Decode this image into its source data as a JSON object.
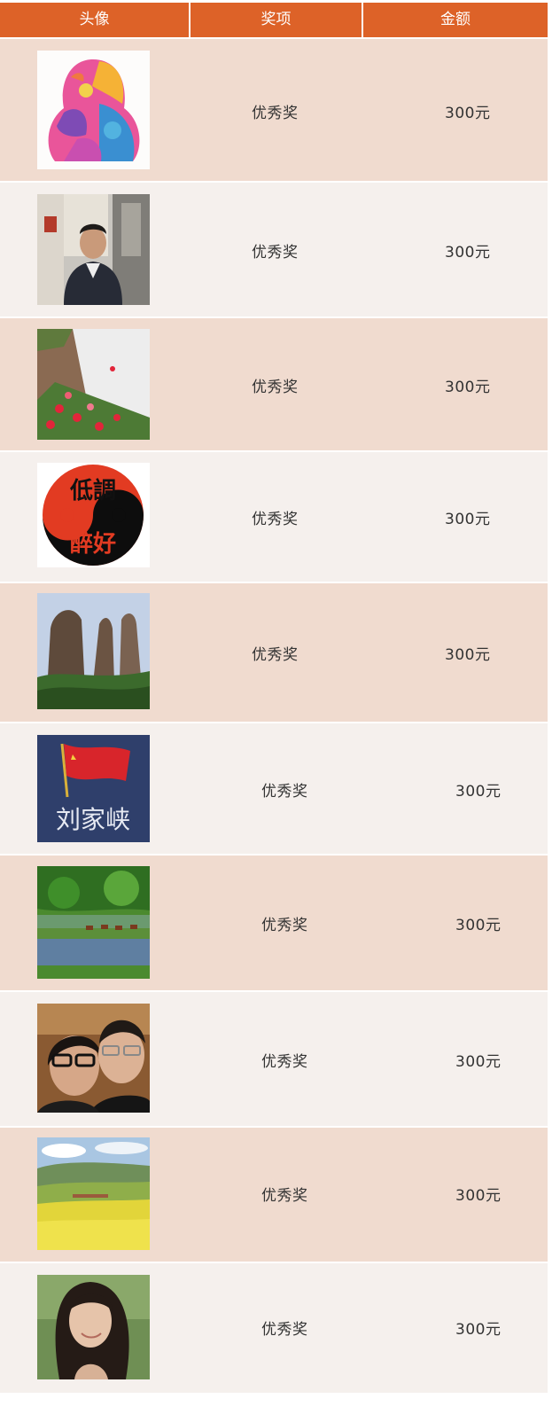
{
  "table": {
    "headers": {
      "avatar": "头像",
      "award": "奖项",
      "amount": "金额"
    },
    "rows": [
      {
        "award": "优秀奖",
        "amount": "300元",
        "avatar_icon": "colorful-penguin-avatar"
      },
      {
        "award": "优秀奖",
        "amount": "300元",
        "avatar_icon": "man-in-office-photo"
      },
      {
        "award": "优秀奖",
        "amount": "300元",
        "avatar_icon": "red-poppies-photo"
      },
      {
        "award": "优秀奖",
        "amount": "300元",
        "avatar_icon": "yin-yang-avatar",
        "avatar_text": [
          "低調",
          "醉好"
        ]
      },
      {
        "award": "优秀奖",
        "amount": "300元",
        "avatar_icon": "rock-peaks-photo"
      },
      {
        "award": "优秀奖",
        "amount": "300元",
        "avatar_icon": "red-flag-avatar",
        "avatar_text": [
          "刘家峡"
        ]
      },
      {
        "award": "优秀奖",
        "amount": "300元",
        "avatar_icon": "lake-horses-photo"
      },
      {
        "award": "优秀奖",
        "amount": "300元",
        "avatar_icon": "couple-selfie-photo"
      },
      {
        "award": "优秀奖",
        "amount": "300元",
        "avatar_icon": "rapeseed-field-photo"
      },
      {
        "award": "优秀奖",
        "amount": "300元",
        "avatar_icon": "woman-portrait-photo"
      }
    ]
  },
  "colors": {
    "header_bg": "#dd6228",
    "row_odd": "#f0dbcf",
    "row_even": "#f5f0ed"
  }
}
